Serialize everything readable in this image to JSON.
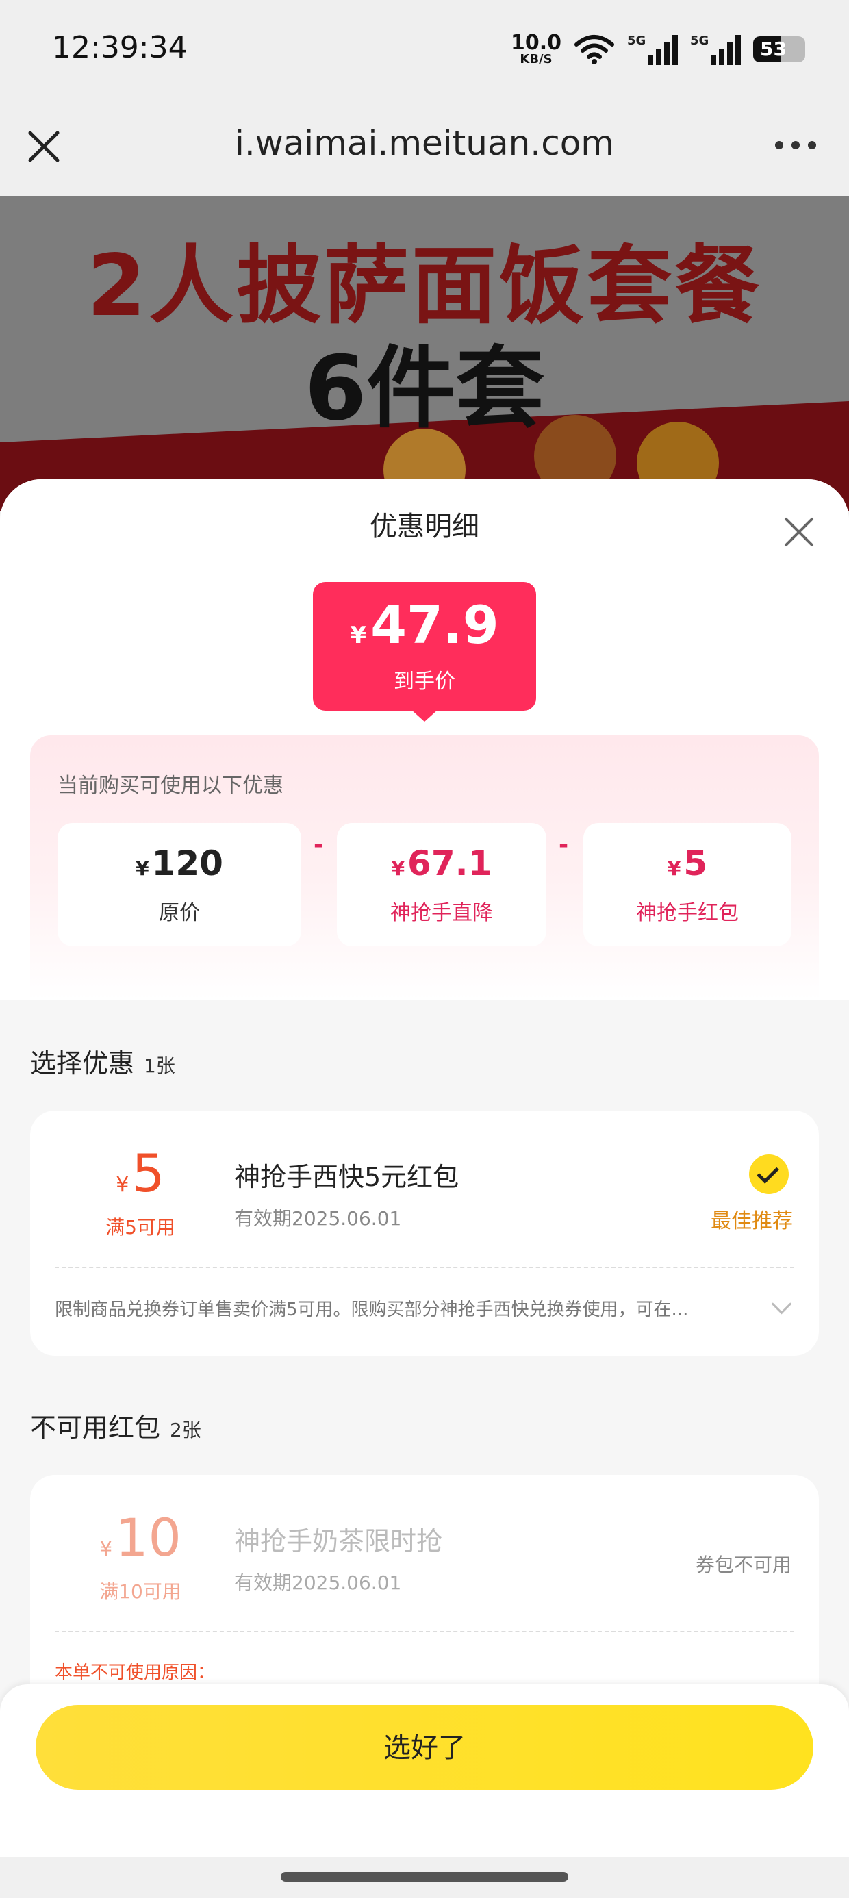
{
  "status_bar": {
    "time": "12:39:34",
    "net_speed": "10.0",
    "net_unit": "KB/S",
    "signal_1": "5G",
    "signal_2": "5G",
    "battery": "53",
    "battery_level": 0.53
  },
  "browser": {
    "url": "i.waimai.meituan.com"
  },
  "banner": {
    "line1": "2人披萨面饭套餐",
    "line2": "6件套"
  },
  "sheet": {
    "title": "优惠明细",
    "final_price": {
      "currency": "¥",
      "amount": "47.9",
      "label": "到手价"
    },
    "summary": {
      "caption": "当前购买可使用以下优惠",
      "items": [
        {
          "currency": "¥",
          "value": "120",
          "label": "原价"
        },
        {
          "currency": "¥",
          "value": "67.1",
          "label": "神抢手直降"
        },
        {
          "currency": "¥",
          "value": "5",
          "label": "神抢手红包"
        }
      ],
      "operator": "-"
    },
    "select_section": {
      "title": "选择优惠",
      "count": "1张"
    },
    "coupon_selected": {
      "currency": "¥",
      "amount": "5",
      "condition": "满5可用",
      "name": "神抢手西快5元红包",
      "validity": "有效期2025.06.01",
      "badge": "最佳推荐",
      "description": "限制商品兑换券订单售卖价满5可用。限购买部分神抢手西快兑换券使用，可在..."
    },
    "unavailable_section": {
      "title": "不可用红包",
      "count": "2张"
    },
    "coupon_unavailable": {
      "currency": "¥",
      "amount": "10",
      "condition": "满10可用",
      "name": "神抢手奶茶限时抢",
      "validity": "有效期2025.06.01",
      "status": "券包不可用",
      "reason": "本单不可使用原因："
    },
    "confirm_label": "选好了"
  },
  "colors": {
    "accent_pink": "#ff2d5b",
    "coupon_orange": "#f0502a",
    "button_yellow": "#ffdf3a",
    "badge_orange": "#e08a12"
  }
}
